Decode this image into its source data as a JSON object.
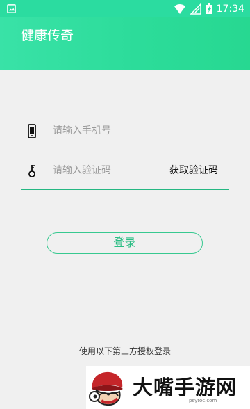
{
  "status_bar": {
    "time": "17:34",
    "icons": [
      "gallery-icon",
      "wifi-icon",
      "signal-icon",
      "battery-charging-icon"
    ]
  },
  "header": {
    "title": "健康传奇"
  },
  "login_form": {
    "phone_placeholder": "请输入手机号",
    "code_placeholder": "请输入验证码",
    "get_code_label": "获取验证码",
    "submit_label": "登录"
  },
  "third_party": {
    "label": "使用以下第三方授权登录"
  },
  "watermark": {
    "brand_text": "大嘴手游网",
    "small_text": "psytoc.com"
  },
  "colors": {
    "header": "#2cdc9a",
    "accent": "#25b782",
    "page_background": "#f0f0f0"
  }
}
